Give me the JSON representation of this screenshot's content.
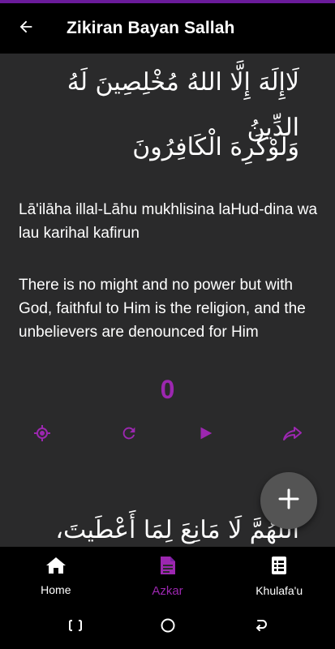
{
  "app_bar": {
    "title": "Zikiran Bayan Sallah"
  },
  "zikir": {
    "arabic_line_1": "لَاإِلَهَ إِلَّا اللهُ مُخْلِصِينَ لَهُ الدِّينُ",
    "arabic_line_2": "وَلَوْكَرِهَ الْكَافِرُونَ",
    "transliteration": "Lā'ilāha illal-Lāhu mukhlisina laHud-dina wa lau karihal kafirun",
    "translation": "There is no might and no power but with God, faithful to Him is the religion, and the unbelievers are denounced for Him",
    "count": "0",
    "next_arabic": "اَللّٰهُمَّ لَا مَانِعَ لِمَا أَعْطَيتَ، وَلَا"
  },
  "icons": {
    "back": "arrow-left-icon",
    "target": "crosshair-icon",
    "reset": "refresh-icon",
    "play": "play-icon",
    "share": "share-icon",
    "fab": "plus-icon",
    "home": "home-icon",
    "azkar": "document-icon",
    "khulafa": "list-icon"
  },
  "bottom_nav": {
    "items": [
      {
        "label": "Home"
      },
      {
        "label": "Azkar"
      },
      {
        "label": "Khulafa'u"
      }
    ],
    "active": "Azkar"
  },
  "colors": {
    "accent": "#9c27b0",
    "status_bar": "#6a1b9a",
    "content_bg": "#2a2a2b",
    "fab_bg": "#545454",
    "bar_bg": "#000000"
  }
}
